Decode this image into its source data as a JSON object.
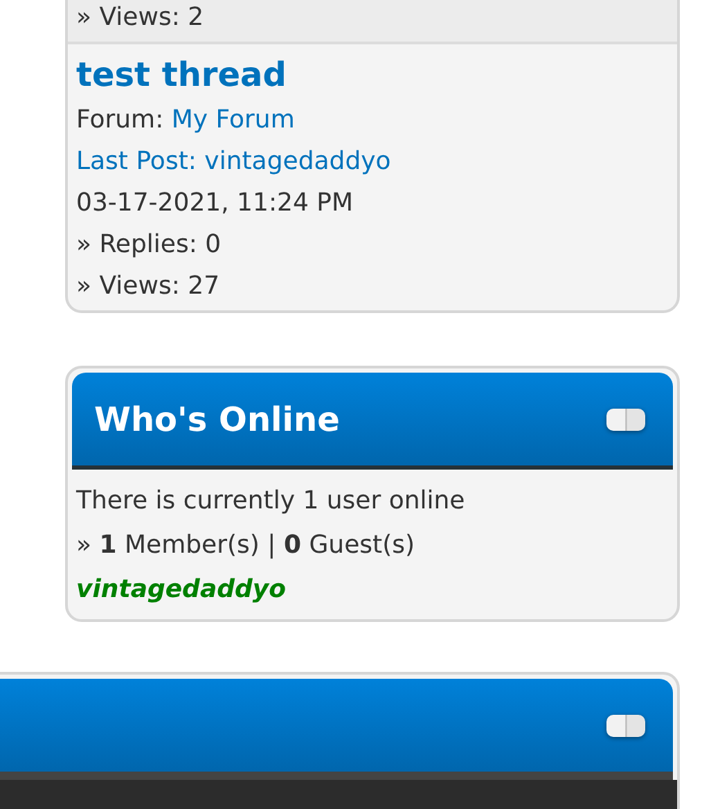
{
  "latest_threads": [
    {
      "views": "» Views: 2"
    },
    {
      "title": "test thread",
      "forum_label": "Forum:",
      "forum": "My Forum",
      "last_post": "Last Post: vintagedaddyo",
      "date": "03-17-2021, 11:24 PM",
      "replies": "» Replies: 0",
      "views": "» Views: 27"
    }
  ],
  "whos_online": {
    "title": "Who's Online",
    "summary": "There is currently 1 user online",
    "counts": "» **1** Member(s) | **0** Guest(s)",
    "members": [
      {
        "name": "vintagedaddyo",
        "color": "#008000"
      }
    ]
  },
  "next_panel": {
    "collapse": true
  }
}
